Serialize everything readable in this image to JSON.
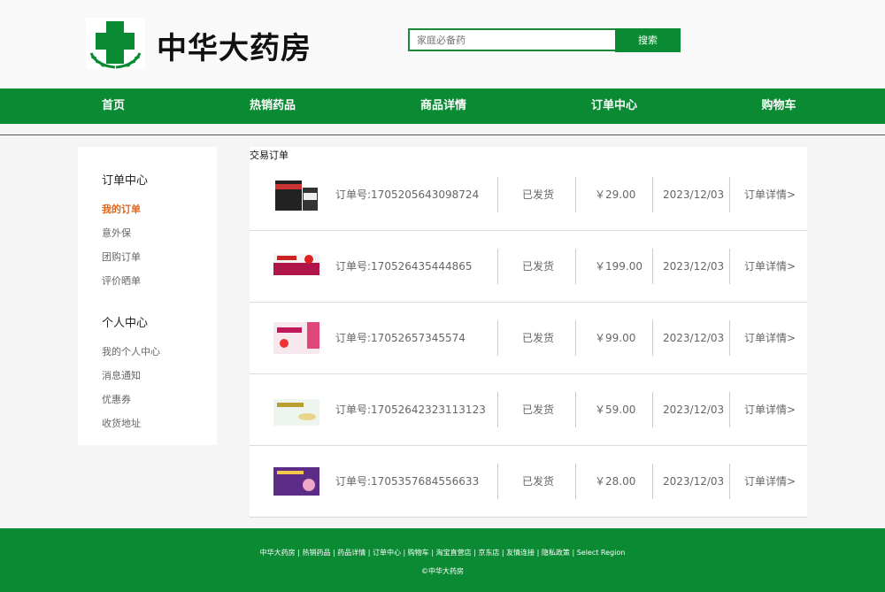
{
  "header": {
    "brand": "中华大药房",
    "search_placeholder": "家庭必备药",
    "search_button": "搜索"
  },
  "nav": {
    "items": [
      "首页",
      "热销药品",
      "商品详情",
      "订单中心",
      "购物车"
    ]
  },
  "sidebar": {
    "section1_title": "订单中心",
    "section1_items": [
      "我的订单",
      "意外保",
      "团购订单",
      "评价晒单"
    ],
    "section2_title": "个人中心",
    "section2_items": [
      "我的个人中心",
      "消息通知",
      "优惠券",
      "收货地址"
    ]
  },
  "orders": {
    "title": "交易订单",
    "rows": [
      {
        "order_no": "订单号:1705205643098724",
        "status": "已发货",
        "price": "￥29.00",
        "date": "2023/12/03",
        "detail": "订单详情>"
      },
      {
        "order_no": "订单号:170526435444865",
        "status": "已发货",
        "price": "￥199.00",
        "date": "2023/12/03",
        "detail": "订单详情>"
      },
      {
        "order_no": "订单号:17052657345574",
        "status": "已发货",
        "price": "￥99.00",
        "date": "2023/12/03",
        "detail": "订单详情>"
      },
      {
        "order_no": "订单号:17052642323113123",
        "status": "已发货",
        "price": "￥59.00",
        "date": "2023/12/03",
        "detail": "订单详情>"
      },
      {
        "order_no": "订单号:1705357684556633",
        "status": "已发货",
        "price": "￥28.00",
        "date": "2023/12/03",
        "detail": "订单详情>"
      }
    ]
  },
  "footer": {
    "links": "中华大药房 | 热销药品 | 药品详情 | 订单中心 | 购物车 | 淘宝直营店 | 京东店 | 友情连接 | 隐私政策 | Select Region",
    "copyright": "©中华大药房"
  },
  "colors": {
    "brand_green": "#0a8a33",
    "active_orange": "#e4631a"
  }
}
